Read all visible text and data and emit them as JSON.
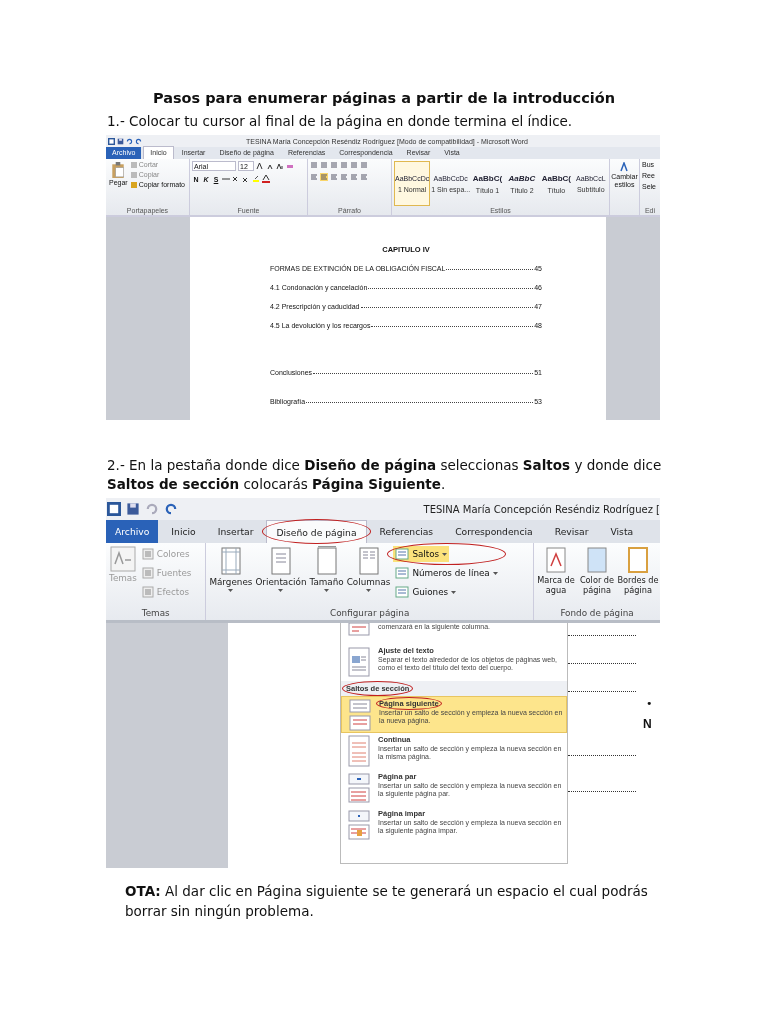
{
  "title": "Pasos para enumerar páginas a partir de la introducción",
  "step_1": {
    "text": "1.- Colocar tu cursor al final de la página en donde termina el índice.",
    "screenshot": {
      "window_title": "TESINA María Concepción Reséndiz Rodríguez [Modo de compatibilidad] - Microsoft Word",
      "tabs": [
        {
          "label": "Archivo",
          "kind": "file",
          "selected": false
        },
        {
          "label": "Inicio",
          "kind": "tab",
          "selected": true
        },
        {
          "label": "Insertar",
          "kind": "tab",
          "selected": false
        },
        {
          "label": "Diseño de página",
          "kind": "tab",
          "selected": false
        },
        {
          "label": "Referencias",
          "kind": "tab",
          "selected": false
        },
        {
          "label": "Correspondencia",
          "kind": "tab",
          "selected": false
        },
        {
          "label": "Revisar",
          "kind": "tab",
          "selected": false
        },
        {
          "label": "Vista",
          "kind": "tab",
          "selected": false
        }
      ],
      "clipboard": {
        "paste": "Pegar",
        "items": [
          "Cortar",
          "Copiar",
          "Copiar formato"
        ]
      },
      "font": {
        "name": "Arial",
        "size": "12",
        "buttons": [
          "N",
          "K",
          "S"
        ]
      },
      "styles": [
        {
          "preview": "AaBbCcDc",
          "label": "1 Normal",
          "kind": "plain",
          "selected": true
        },
        {
          "preview": "AaBbCcDc",
          "label": "1 Sin espa...",
          "kind": "plain",
          "selected": false
        },
        {
          "preview": "AaBbC(",
          "label": "Título 1",
          "kind": "heading",
          "selected": false
        },
        {
          "preview": "AaBbC",
          "label": "Título 2",
          "kind": "emphasis",
          "selected": false
        },
        {
          "preview": "AaBbC(",
          "label": "Título",
          "kind": "heading",
          "selected": false
        },
        {
          "preview": "AaBbCcL",
          "label": "Subtítulo",
          "kind": "plain",
          "selected": false
        }
      ],
      "change_styles": "Cambiar estilos",
      "editing": [
        "Bus",
        "Ree",
        "Sele"
      ],
      "groups": [
        "Portapapeles",
        "Fuente",
        "Párrafo",
        "Estilos",
        "Edi"
      ],
      "document": {
        "heading": "CAPITULO IV",
        "chapter_entries": [
          {
            "entry": "FORMAS DE EXTINCIÓN DE LA OBLIGACIÓN FISCAL",
            "page": "45"
          },
          {
            "entry": "4.1 Condonación y cancelación",
            "page": "46"
          },
          {
            "entry": "4.2 Prescripción y caducidad",
            "page": "47"
          },
          {
            "entry": "4.5 La devolución y los recargos",
            "page": "48"
          }
        ],
        "closing_entries": [
          {
            "entry": "Conclusiones",
            "page": "51"
          },
          {
            "entry": "Bibliografía",
            "page": "53"
          }
        ]
      }
    }
  },
  "step_2": {
    "text": "2.- En la pestaña donde dice **Diseño de página** seleccionas **Saltos** y donde dice **Saltos de sección** colocarás **Página Siguiente**.",
    "screenshot": {
      "window_title": "TESINA María Concepción Reséndiz Rodríguez [",
      "tabs": [
        {
          "label": "Archivo",
          "kind": "file",
          "selected": false,
          "circled": false
        },
        {
          "label": "Inicio",
          "kind": "tab",
          "selected": false,
          "circled": false
        },
        {
          "label": "Insertar",
          "kind": "tab",
          "selected": false,
          "circled": false
        },
        {
          "label": "Diseño de página",
          "kind": "tab",
          "selected": true,
          "circled": true
        },
        {
          "label": "Referencias",
          "kind": "tab",
          "selected": false,
          "circled": false
        },
        {
          "label": "Correspondencia",
          "kind": "tab",
          "selected": false,
          "circled": false
        },
        {
          "label": "Revisar",
          "kind": "tab",
          "selected": false,
          "circled": false
        },
        {
          "label": "Vista",
          "kind": "tab",
          "selected": false,
          "circled": false
        }
      ],
      "themes": {
        "button": "Temas",
        "disabled": true,
        "items": [
          "Colores",
          "Fuentes",
          "Efectos"
        ],
        "group": "Temas"
      },
      "page_setup": {
        "buttons": [
          "Márgenes",
          "Orientación",
          "Tamaño",
          "Columnas"
        ],
        "small_buttons": [
          {
            "label": "Saltos",
            "highlighted": true,
            "circled": true
          },
          {
            "label": "Números de línea",
            "highlighted": false,
            "circled": false
          },
          {
            "label": "Guiones",
            "highlighted": false,
            "circled": false
          }
        ],
        "group": "Configurar página"
      },
      "page_background": {
        "buttons": [
          "Marca de agua",
          "Color de página",
          "Bordes de página"
        ],
        "group": "Fondo de página"
      },
      "menu": [
        {
          "kind": "partial",
          "description": "comenzará en la siguiente columna."
        },
        {
          "kind": "wrap",
          "title": "Ajuste del texto",
          "description": "Separar el texto alrededor de los objetos de páginas web, como el texto del título del texto del cuerpo.",
          "selected": false,
          "circled": false
        },
        {
          "kind": "header",
          "label": "Saltos de sección",
          "circled": true
        },
        {
          "kind": "next",
          "title": "Página siguiente",
          "description": "Insertar un salto de sección y empieza la nueva sección en la nueva página.",
          "selected": true,
          "circled": true
        },
        {
          "kind": "continuous",
          "title": "Continua",
          "description": "Insertar un salto de sección y empieza la nueva sección en la misma página.",
          "selected": false,
          "circled": false
        },
        {
          "kind": "even",
          "title": "Página par",
          "description": "Insertar un salto de sección y empieza la nueva sección en la siguiente página par.",
          "selected": false,
          "circled": false
        },
        {
          "kind": "odd",
          "title": "Página impar",
          "description": "Insertar un salto de sección y empieza la nueva sección en la siguiente página impar.",
          "selected": false,
          "circled": false
        }
      ],
      "page_text": [
        "•",
        "N"
      ]
    }
  },
  "note": "**OTA:** Al dar clic en Página siguiente se te generará un espacio el cual podrás borrar sin ningún problema."
}
